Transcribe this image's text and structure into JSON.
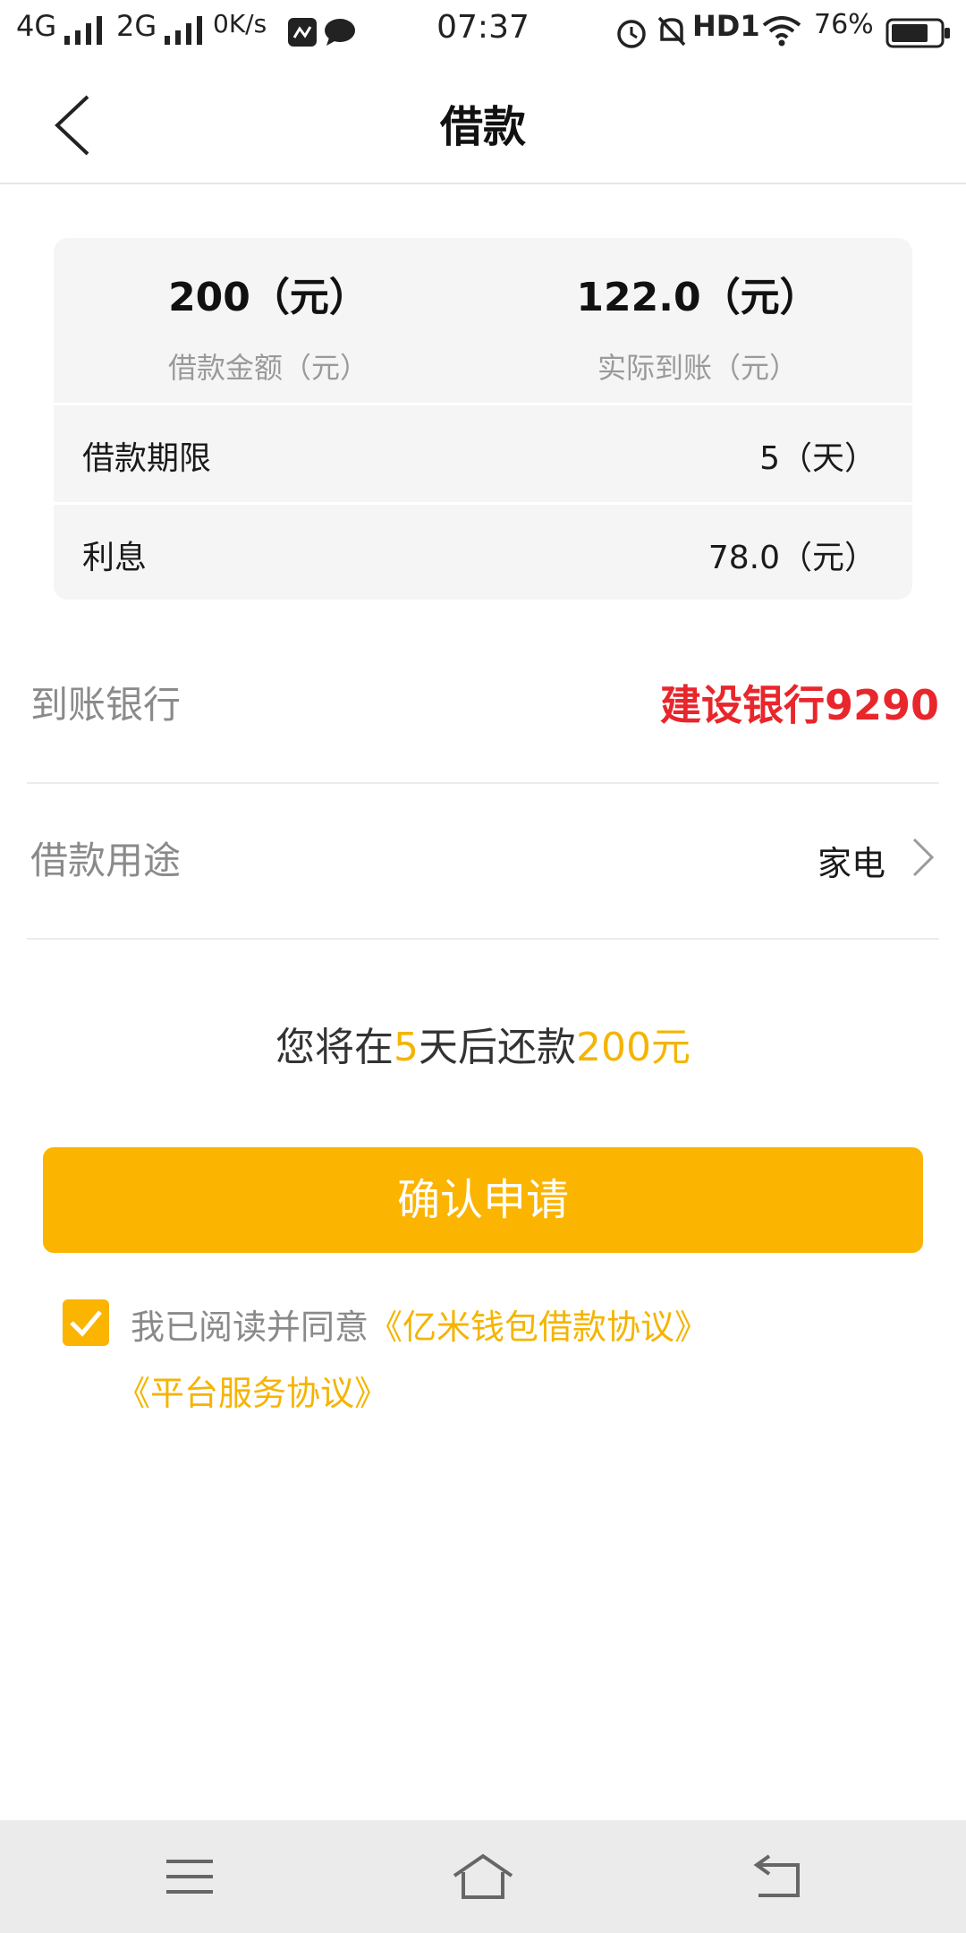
{
  "status_bar": {
    "network1": "4G",
    "network2": "2G",
    "speed": "0K/s",
    "time": "07:37",
    "hd": "HD1",
    "battery": "76%"
  },
  "header": {
    "title": "借款"
  },
  "summary": {
    "amount_value": "200（元）",
    "amount_label": "借款金额（元）",
    "received_value": "122.0（元）",
    "received_label": "实际到账（元）",
    "term_label": "借款期限",
    "term_value": "5（天）",
    "interest_label": "利息",
    "interest_value": "78.0（元）"
  },
  "form": {
    "bank_label": "到账银行",
    "bank_value": "建设银行9290",
    "purpose_label": "借款用途",
    "purpose_value": "家电"
  },
  "repay_note": {
    "part1": "您将在",
    "days": "5",
    "part2": "天后还款",
    "amount": "200元"
  },
  "confirm_label": "确认申请",
  "agreement": {
    "prefix": "我已阅读并同意",
    "link1": "《亿米钱包借款协议》",
    "link2": "《平台服务协议》",
    "checked": true
  },
  "icons": {
    "back": "chevron-left-icon",
    "chevron": "chevron-right-icon",
    "check": "check-icon",
    "menu": "menu-icon",
    "home": "home-icon",
    "return": "back-arrow-icon"
  },
  "colors": {
    "accent": "#fbb400",
    "bank_red": "#e8262c"
  }
}
